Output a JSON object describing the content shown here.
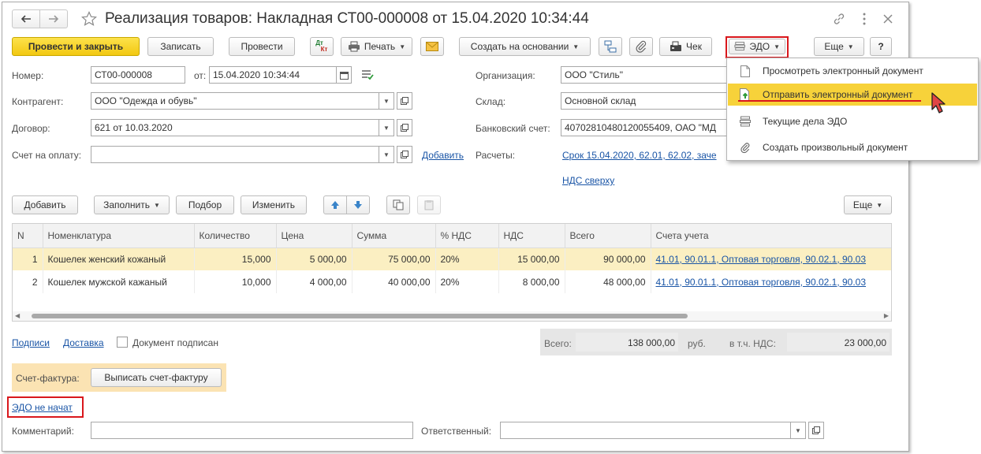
{
  "window": {
    "title": "Реализация товаров: Накладная СТ00-000008 от 15.04.2020 10:34:44",
    "icons": [
      "back-arrow-icon",
      "forward-arrow-icon",
      "star-icon",
      "link-icon",
      "more-vertical-icon",
      "close-icon"
    ]
  },
  "toolbar": {
    "post_close": "Провести и закрыть",
    "save": "Записать",
    "post": "Провести",
    "dtkt_top": "Дт",
    "dtkt_bottom": "Кт",
    "print": "Печать",
    "create_based": "Создать на основании",
    "check": "Чек",
    "edo": "ЭДО",
    "more": "Еще",
    "help": "?"
  },
  "form": {
    "number_label": "Номер:",
    "number_value": "СТ00-000008",
    "from_label": "от:",
    "date_value": "15.04.2020 10:34:44",
    "counterparty_label": "Контрагент:",
    "counterparty_value": "ООО \"Одежда и обувь\"",
    "contract_label": "Договор:",
    "contract_value": "621 от 10.03.2020",
    "invoice_label": "Счет на оплату:",
    "invoice_value": "",
    "invoice_add": "Добавить",
    "org_label": "Организация:",
    "org_value": "ООО \"Стиль\"",
    "warehouse_label": "Склад:",
    "warehouse_value": "Основной склад",
    "bank_label": "Банковский счет:",
    "bank_value": "40702810480120055409, ОАО \"МД",
    "settlements_label": "Расчеты:",
    "settlements_link": "Срок 15.04.2020, 62.01, 62.02, заче",
    "vat_link": "НДС сверху"
  },
  "table_toolbar": {
    "add": "Добавить",
    "fill": "Заполнить",
    "pick": "Подбор",
    "change": "Изменить",
    "more": "Еще"
  },
  "table": {
    "columns": [
      "N",
      "Номенклатура",
      "Количество",
      "Цена",
      "Сумма",
      "% НДС",
      "НДС",
      "Всего",
      "Счета учета"
    ],
    "rows": [
      {
        "n": "1",
        "item": "Кошелек женский кожаный",
        "qty": "15,000",
        "price": "5 000,00",
        "sum": "75 000,00",
        "vat_rate": "20%",
        "vat": "15 000,00",
        "total": "90 000,00",
        "accounts": "41.01, 90.01.1, Оптовая торговля, 90.02.1, 90.03"
      },
      {
        "n": "2",
        "item": "Кошелек мужской кажаный",
        "qty": "10,000",
        "price": "4 000,00",
        "sum": "40 000,00",
        "vat_rate": "20%",
        "vat": "8 000,00",
        "total": "48 000,00",
        "accounts": "41.01, 90.01.1, Оптовая торговля, 90.02.1, 90.03"
      }
    ]
  },
  "footer": {
    "signatures_link": "Подписи",
    "delivery_link": "Доставка",
    "signed_label": "Документ подписан",
    "total_label": "Всего:",
    "total_value": "138 000,00",
    "currency": "руб.",
    "vat_incl_label": "в т.ч. НДС:",
    "vat_incl_value": "23 000,00",
    "sf_label": "Счет-фактура:",
    "sf_button": "Выписать счет-фактуру",
    "edo_status": "ЭДО не начат",
    "comment_label": "Комментарий:",
    "comment_value": "",
    "responsible_label": "Ответственный:",
    "responsible_value": ""
  },
  "edo_menu": {
    "items": [
      {
        "label": "Просмотреть электронный документ",
        "icon": "document-icon"
      },
      {
        "label": "Отправить электронный документ",
        "icon": "send-document-icon"
      },
      {
        "label": "Текущие дела ЭДО",
        "icon": "edo-tasks-icon"
      },
      {
        "label": "Создать произвольный документ",
        "icon": "paperclip-icon"
      }
    ]
  },
  "colors": {
    "primary_button": "#f2c811",
    "selected_row": "#fbefc2",
    "menu_highlight": "#f7d23a",
    "link": "#1a55a6",
    "highlight_box": "#d9171c",
    "invoice_panel": "#fbe3b3"
  }
}
